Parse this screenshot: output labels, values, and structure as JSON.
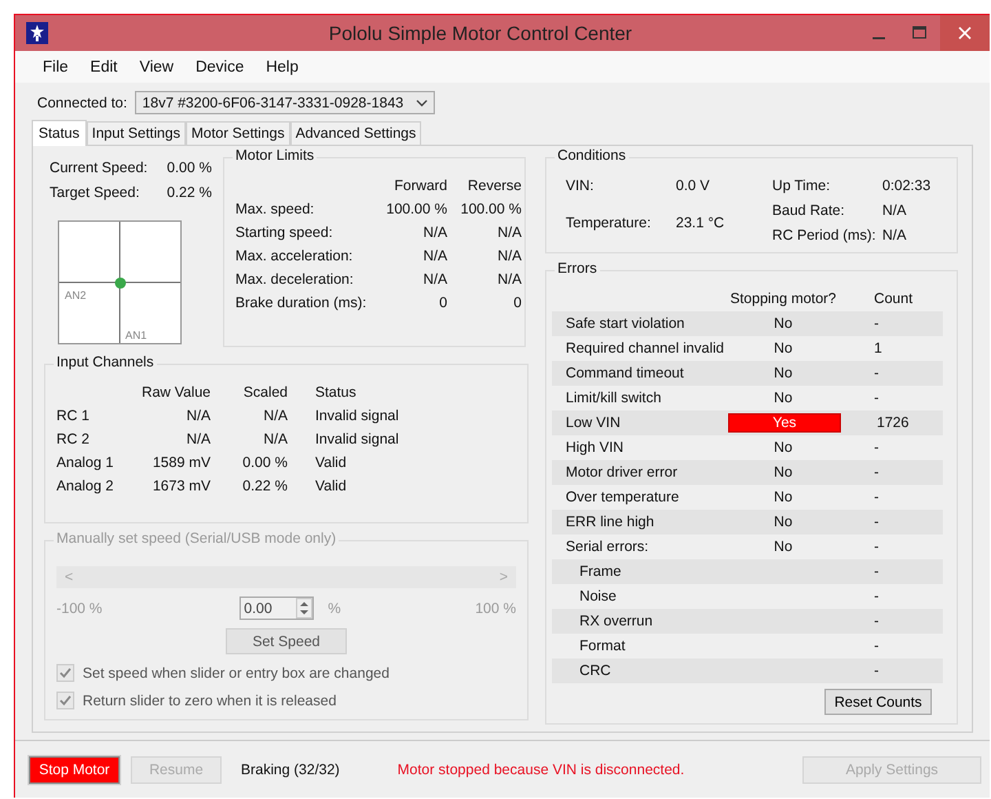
{
  "window": {
    "title": "Pololu Simple Motor Control Center"
  },
  "menu": [
    "File",
    "Edit",
    "View",
    "Device",
    "Help"
  ],
  "connection": {
    "label": "Connected to:",
    "value": "18v7 #3200-6F06-3147-3331-0928-1843"
  },
  "tabs": [
    {
      "label": "Status",
      "selected": true
    },
    {
      "label": "Input Settings",
      "selected": false
    },
    {
      "label": "Motor Settings",
      "selected": false
    },
    {
      "label": "Advanced Settings",
      "selected": false
    }
  ],
  "speed": [
    {
      "label": "Current Speed:",
      "value": "0.00 %"
    },
    {
      "label": "Target Speed:",
      "value": "0.22 %"
    }
  ],
  "position_plot": {
    "x_label": "AN1",
    "y_label": "AN2"
  },
  "motor_limits": {
    "title": "Motor Limits",
    "columns": [
      "Forward",
      "Reverse"
    ],
    "rows": [
      {
        "label": "Max. speed:",
        "forward": "100.00 %",
        "reverse": "100.00 %"
      },
      {
        "label": "Starting speed:",
        "forward": "N/A",
        "reverse": "N/A"
      },
      {
        "label": "Max. acceleration:",
        "forward": "N/A",
        "reverse": "N/A"
      },
      {
        "label": "Max. deceleration:",
        "forward": "N/A",
        "reverse": "N/A"
      },
      {
        "label": "Brake duration (ms):",
        "forward": "0",
        "reverse": "0"
      }
    ]
  },
  "input_channels": {
    "title": "Input Channels",
    "columns": [
      "Raw Value",
      "Scaled",
      "Status"
    ],
    "rows": [
      {
        "name": "RC 1",
        "raw": "N/A",
        "scaled": "N/A",
        "status": "Invalid signal"
      },
      {
        "name": "RC 2",
        "raw": "N/A",
        "scaled": "N/A",
        "status": "Invalid signal"
      },
      {
        "name": "Analog 1",
        "raw": "1589 mV",
        "scaled": "0.00 %",
        "status": "Valid"
      },
      {
        "name": "Analog 2",
        "raw": "1673 mV",
        "scaled": "0.22 %",
        "status": "Valid"
      }
    ]
  },
  "manual_speed": {
    "title": "Manually set speed (Serial/USB mode only)",
    "disabled": true,
    "slider_left": "<",
    "slider_right": ">",
    "min_label": "-100 %",
    "max_label": "100 %",
    "value": "0.00",
    "unit": "%",
    "button": "Set Speed",
    "options": [
      {
        "label": "Set speed when slider or entry box are changed",
        "checked": true
      },
      {
        "label": "Return slider to zero when it is released",
        "checked": true
      }
    ]
  },
  "conditions": {
    "title": "Conditions",
    "left": [
      {
        "label": "VIN:",
        "value": "0.0 V"
      },
      {
        "label": "Temperature:",
        "value": "23.1 °C"
      }
    ],
    "right": [
      {
        "label": "Up Time:",
        "value": "0:02:33"
      },
      {
        "label": "Baud Rate:",
        "value": "N/A"
      },
      {
        "label": "RC Period (ms):",
        "value": "N/A"
      }
    ]
  },
  "errors": {
    "title": "Errors",
    "columns": [
      "Stopping motor?",
      "Count"
    ],
    "rows": [
      {
        "label": "Safe start violation",
        "stopping": "No",
        "alert": false,
        "count": "-"
      },
      {
        "label": "Required channel invalid",
        "stopping": "No",
        "alert": false,
        "count": "1"
      },
      {
        "label": "Command timeout",
        "stopping": "No",
        "alert": false,
        "count": "-"
      },
      {
        "label": "Limit/kill switch",
        "stopping": "No",
        "alert": false,
        "count": "-"
      },
      {
        "label": "Low VIN",
        "stopping": "Yes",
        "alert": true,
        "count": "1726"
      },
      {
        "label": "High VIN",
        "stopping": "No",
        "alert": false,
        "count": "-"
      },
      {
        "label": "Motor driver error",
        "stopping": "No",
        "alert": false,
        "count": "-"
      },
      {
        "label": "Over temperature",
        "stopping": "No",
        "alert": false,
        "count": "-"
      },
      {
        "label": "ERR line high",
        "stopping": "No",
        "alert": false,
        "count": "-"
      },
      {
        "label": "Serial errors:",
        "stopping": "No",
        "alert": false,
        "count": "-",
        "children": [
          {
            "label": "Frame",
            "count": "-"
          },
          {
            "label": "Noise",
            "count": "-"
          },
          {
            "label": "RX overrun",
            "count": "-"
          },
          {
            "label": "Format",
            "count": "-"
          },
          {
            "label": "CRC",
            "count": "-"
          }
        ]
      }
    ],
    "reset_button": "Reset Counts"
  },
  "status_bar": {
    "stop_button": "Stop Motor",
    "resume_button": {
      "label": "Resume",
      "disabled": true
    },
    "state": "Braking (32/32)",
    "message": "Motor stopped because VIN is disconnected.",
    "apply_button": {
      "label": "Apply Settings",
      "disabled": true
    }
  }
}
